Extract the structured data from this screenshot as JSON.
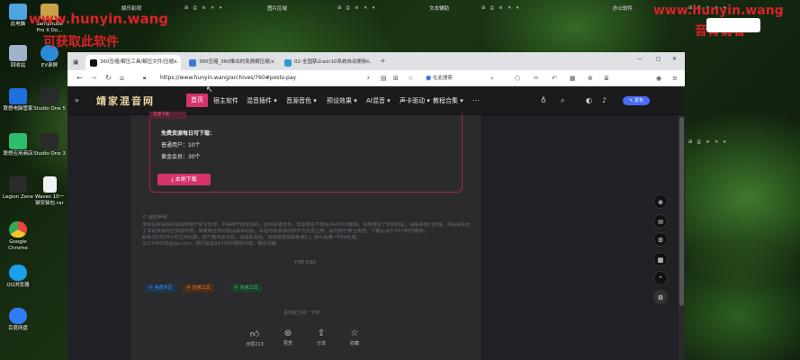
{
  "desktop": {
    "icons": [
      {
        "label": "此电脑",
        "color": "#4fa3e0"
      },
      {
        "label": "Sampitude Pro X Do...",
        "color": "#c9a24a"
      },
      {
        "label": "回收站",
        "color": "#9fb4c8"
      },
      {
        "label": "EV录屏",
        "color": "#2d8ad6"
      },
      {
        "label": "联想电脑管家",
        "color": "#1f6fe0"
      },
      {
        "label": "Studio One 5",
        "color": "#2a2a2a"
      },
      {
        "label": "联想应用商店",
        "color": "#2dbd6e"
      },
      {
        "label": "Studio One 3",
        "color": "#2a2a2a"
      },
      {
        "label": "Legion Zone",
        "color": "#2b2b2b"
      },
      {
        "label": "Waves 10一键安装包.rar",
        "color": "#f2f2f2"
      },
      {
        "label": "Google Chrome",
        "color": "#e8453c"
      },
      {
        "label": "QQ浏览器",
        "color": "#1aa0e8"
      },
      {
        "label": "百度网盘",
        "color": "#2f7cf6"
      }
    ]
  },
  "top_strip": {
    "items": [
      "娱乐影视",
      "图片区域",
      "文本辅助",
      "办公软件"
    ]
  },
  "watermark": {
    "left_line1": "www.hunyin.wang",
    "left_line2": "可获取此软件",
    "right_line1": "www.hunyin.wang",
    "right_line2": "音青请看"
  },
  "browser": {
    "tabs": [
      {
        "title": "360压缩/解压工具/解压文件/压缩...",
        "active": true
      },
      {
        "title": "360压缩_360推出的免费解压缩...",
        "active": false
      },
      {
        "title": "02-全国禁止win10系统自动更新...",
        "active": false
      }
    ],
    "url": "https://www.hunyin.wang/archives/760#posts-pay",
    "search_placeholder": "在此搜索"
  },
  "site": {
    "logo": "靖家混音网",
    "menu": [
      "首页",
      "宿主软件",
      "混音插件",
      "音源音色",
      "预设效果",
      "AI混音",
      "声卡驱动",
      "教程合集"
    ],
    "post_button": "发布"
  },
  "download": {
    "tag": "资源下载",
    "title": "免费资源每日可下载：",
    "normal_user": "普通用户：10个",
    "gold_member": "黄金会员：30个",
    "button": "本地下载"
  },
  "notice": {
    "heading": "© 版权声明",
    "body1": "本网站所提供的资源仅用于学习交流，不得用于商业目的，否则后果自负。您需要在下载后24小时内删除。如果侵犯了您的权益，请联系我们处理。本站资源大部分来源于网络，如有侵权，请联系站长删除。",
    "body2": "了本站资源均已测试可用，如果有任何问题请联系站长。本站所有资源仅供学习交流之用，请勿用于商业用途。下载后请于24小时内删除。",
    "body3": "联系QQ号24小时之内回复，如下载资源失效，请联系站长。如有侵权请联系我们，我们会第一时间处理。",
    "body4": "311745158@qq.com。我们会在24小时内删除内容。敬请谅解",
    "end": "THE END"
  },
  "tags": [
    {
      "label": "免费专区",
      "color": "#3a8fd8",
      "bg": "#1f3550"
    },
    {
      "label": "应用工具",
      "color": "#e07a3a",
      "bg": "#4a2c1c"
    },
    {
      "label": "实用工具",
      "color": "#3fb56a",
      "bg": "#1c3f28"
    }
  ],
  "prev_text": "喜欢就支持一下吧",
  "actions": [
    {
      "icon": "thumb-up",
      "label": "点赞213"
    },
    {
      "icon": "coin",
      "label": "赞赏"
    },
    {
      "icon": "share",
      "label": "分享"
    },
    {
      "icon": "star",
      "label": "收藏"
    }
  ]
}
